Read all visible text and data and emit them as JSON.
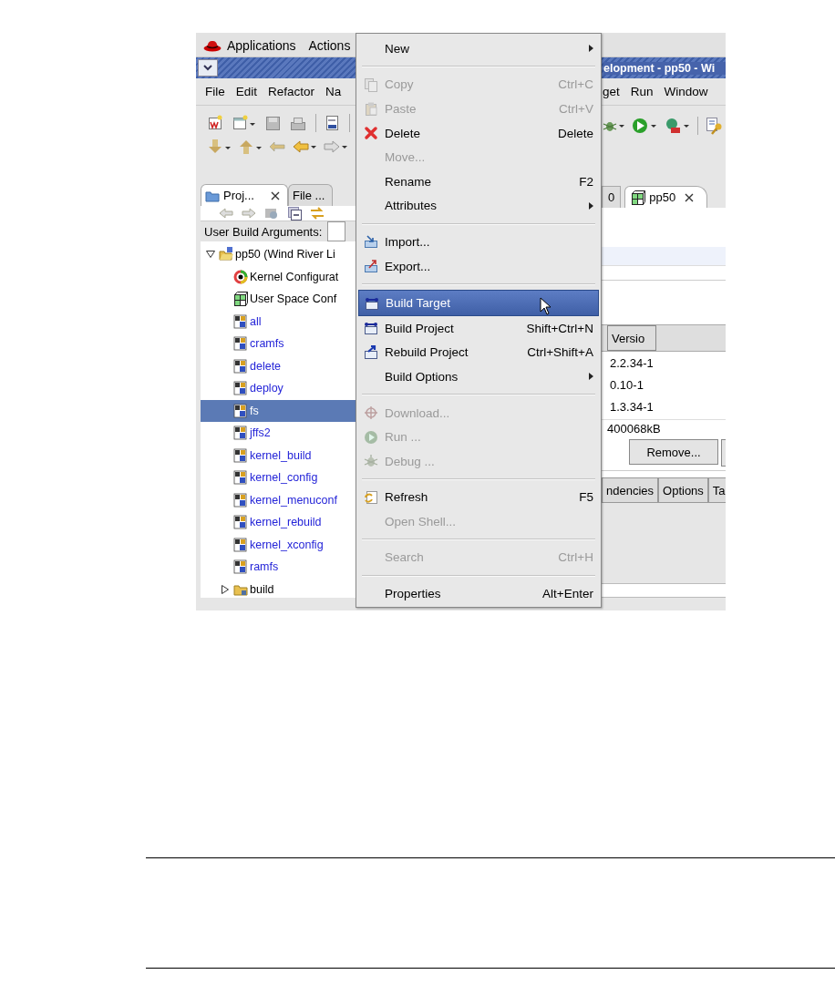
{
  "desktop_panel": {
    "items": [
      "Applications",
      "Actions"
    ]
  },
  "window": {
    "title": "elopment - pp50 - Wi"
  },
  "menu_bar": {
    "left": [
      "File",
      "Edit",
      "Refactor",
      "Na"
    ],
    "right": [
      "get",
      "Run",
      "Window"
    ]
  },
  "project_explorer": {
    "tabs": [
      {
        "label": "Proj...",
        "selected": true
      },
      {
        "label": "File ...",
        "selected": false
      }
    ],
    "build_arguments": {
      "label": "User Build Arguments:"
    },
    "tree": [
      {
        "label": "pp50 (Wind River Li",
        "kind": "project",
        "expanded": true,
        "selected": false,
        "children": [
          {
            "label": "Kernel Configurat",
            "kind": "kernel",
            "selected": false
          },
          {
            "label": "User Space Conf",
            "kind": "userspace",
            "selected": false
          },
          {
            "label": "all",
            "kind": "target",
            "selected": false
          },
          {
            "label": "cramfs",
            "kind": "target",
            "selected": false
          },
          {
            "label": "delete",
            "kind": "target",
            "selected": false
          },
          {
            "label": "deploy",
            "kind": "target",
            "selected": false
          },
          {
            "label": "fs",
            "kind": "target",
            "selected": true
          },
          {
            "label": "jffs2",
            "kind": "target",
            "selected": false
          },
          {
            "label": "kernel_build",
            "kind": "target",
            "selected": false
          },
          {
            "label": "kernel_config",
            "kind": "target",
            "selected": false
          },
          {
            "label": "kernel_menuconf",
            "kind": "target",
            "selected": false
          },
          {
            "label": "kernel_rebuild",
            "kind": "target",
            "selected": false
          },
          {
            "label": "kernel_xconfig",
            "kind": "target",
            "selected": false
          },
          {
            "label": "ramfs",
            "kind": "target",
            "selected": false
          },
          {
            "label": "build",
            "kind": "folder",
            "expanded": false,
            "selected": false
          }
        ]
      }
    ]
  },
  "editor": {
    "tabs": [
      {
        "label": "0",
        "selected": false
      },
      {
        "label": "pp50",
        "selected": true
      }
    ],
    "table": {
      "columns": [
        "Versio"
      ],
      "rows": [
        [
          "2.2.34-1"
        ],
        [
          "0.10-1"
        ],
        [
          "1.3.34-1"
        ]
      ]
    },
    "size": "400068kB",
    "remove_button": "Remove...",
    "bottom_tabs": [
      "ndencies",
      "Options",
      "Ta"
    ]
  },
  "context_menu": {
    "items": [
      {
        "kind": "item",
        "label": "New",
        "submenu": true,
        "disabled": false,
        "selected": false
      },
      {
        "kind": "separator"
      },
      {
        "kind": "item",
        "label": "Copy",
        "shortcut": "Ctrl+C",
        "disabled": true,
        "selected": false
      },
      {
        "kind": "item",
        "label": "Paste",
        "shortcut": "Ctrl+V",
        "disabled": true,
        "selected": false
      },
      {
        "kind": "item",
        "label": "Delete",
        "shortcut": "Delete",
        "disabled": false,
        "selected": false
      },
      {
        "kind": "item",
        "label": "Move...",
        "disabled": true,
        "selected": false
      },
      {
        "kind": "item",
        "label": "Rename",
        "shortcut": "F2",
        "disabled": false,
        "selected": false
      },
      {
        "kind": "item",
        "label": "Attributes",
        "submenu": true,
        "disabled": false,
        "selected": false
      },
      {
        "kind": "separator"
      },
      {
        "kind": "item",
        "label": "Import...",
        "disabled": false,
        "selected": false
      },
      {
        "kind": "item",
        "label": "Export...",
        "disabled": false,
        "selected": false
      },
      {
        "kind": "separator"
      },
      {
        "kind": "item",
        "label": "Build Target",
        "disabled": false,
        "selected": true
      },
      {
        "kind": "item",
        "label": "Build Project",
        "shortcut": "Shift+Ctrl+N",
        "disabled": false,
        "selected": false
      },
      {
        "kind": "item",
        "label": "Rebuild Project",
        "shortcut": "Ctrl+Shift+A",
        "disabled": false,
        "selected": false
      },
      {
        "kind": "item",
        "label": "Build Options",
        "submenu": true,
        "disabled": false,
        "selected": false
      },
      {
        "kind": "separator"
      },
      {
        "kind": "item",
        "label": "Download...",
        "disabled": true,
        "selected": false
      },
      {
        "kind": "item",
        "label": "Run ...",
        "disabled": true,
        "selected": false
      },
      {
        "kind": "item",
        "label": "Debug ...",
        "disabled": true,
        "selected": false
      },
      {
        "kind": "separator"
      },
      {
        "kind": "item",
        "label": "Refresh",
        "shortcut": "F5",
        "disabled": false,
        "selected": false
      },
      {
        "kind": "item",
        "label": "Open Shell...",
        "disabled": true,
        "selected": false
      },
      {
        "kind": "separator"
      },
      {
        "kind": "item",
        "label": "Search",
        "shortcut": "Ctrl+H",
        "disabled": true,
        "selected": false
      },
      {
        "kind": "separator"
      },
      {
        "kind": "item",
        "label": "Properties",
        "shortcut": "Alt+Enter",
        "disabled": false,
        "selected": false
      }
    ]
  }
}
